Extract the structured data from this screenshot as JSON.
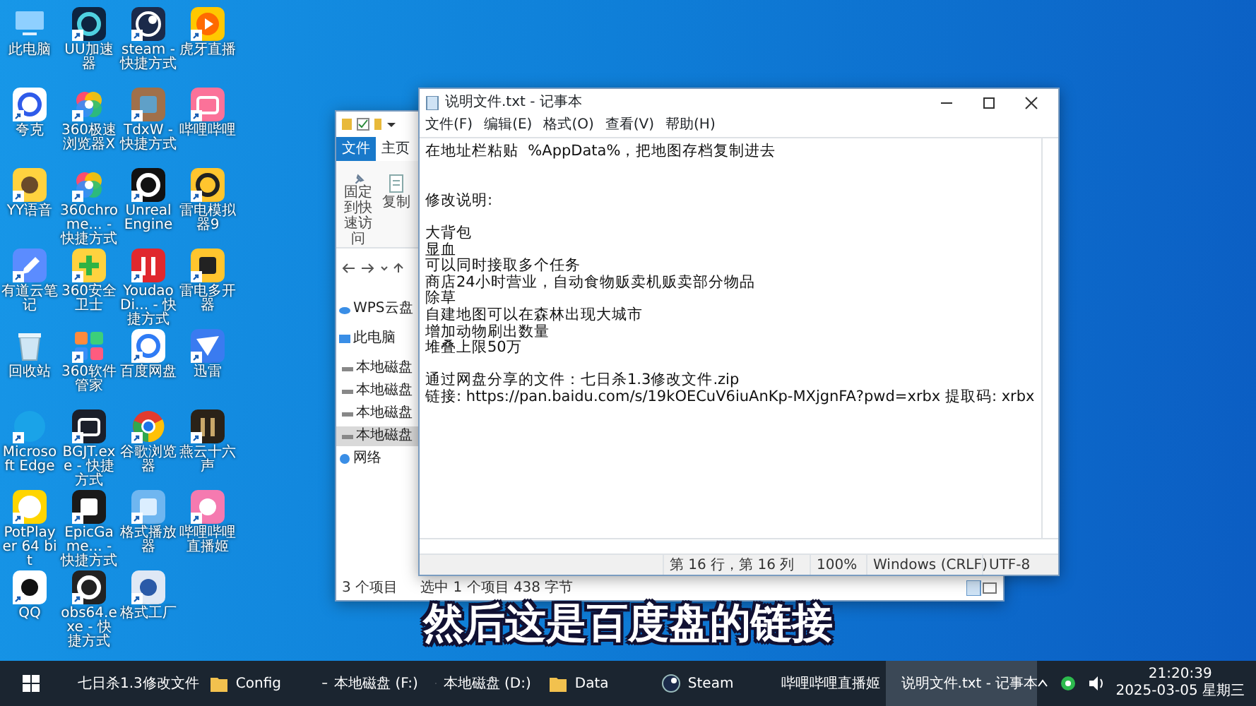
{
  "desktop_icons": [
    {
      "label": "此电脑",
      "shortcut": false
    },
    {
      "label": "UU加速器",
      "shortcut": true
    },
    {
      "label": "steam - 快捷方式",
      "shortcut": true
    },
    {
      "label": "虎牙直播",
      "shortcut": true
    },
    {
      "label": "夸克",
      "shortcut": true
    },
    {
      "label": "360极速浏览器X",
      "shortcut": true
    },
    {
      "label": "TdxW - 快捷方式",
      "shortcut": true
    },
    {
      "label": "哔哩哔哩",
      "shortcut": true
    },
    {
      "label": "YY语音",
      "shortcut": true
    },
    {
      "label": "360chrome... - 快捷方式",
      "shortcut": true
    },
    {
      "label": "Unreal Engine",
      "shortcut": true
    },
    {
      "label": "雷电模拟器9",
      "shortcut": true
    },
    {
      "label": "有道云笔记",
      "shortcut": true
    },
    {
      "label": "360安全卫士",
      "shortcut": true
    },
    {
      "label": "YoudaoDi... - 快捷方式",
      "shortcut": true
    },
    {
      "label": "雷电多开器",
      "shortcut": true
    },
    {
      "label": "回收站",
      "shortcut": false
    },
    {
      "label": "360软件管家",
      "shortcut": true
    },
    {
      "label": "百度网盘",
      "shortcut": true
    },
    {
      "label": "迅雷",
      "shortcut": true
    },
    {
      "label": "Microsoft Edge",
      "shortcut": true
    },
    {
      "label": "BGJT.exe - 快捷方式",
      "shortcut": true
    },
    {
      "label": "谷歌浏览器",
      "shortcut": true
    },
    {
      "label": "燕云十六声",
      "shortcut": true
    },
    {
      "label": "PotPlayer 64 bit",
      "shortcut": true
    },
    {
      "label": "EpicGame... - 快捷方式",
      "shortcut": true
    },
    {
      "label": "格式播放器",
      "shortcut": true
    },
    {
      "label": "哔哩哔哩直播姬",
      "shortcut": true
    },
    {
      "label": "QQ",
      "shortcut": true
    },
    {
      "label": "obs64.exe - 快捷方式",
      "shortcut": true
    },
    {
      "label": "格式工厂",
      "shortcut": true
    }
  ],
  "explorer": {
    "ribbon_tabs": [
      {
        "label": "文件",
        "selected": true
      },
      {
        "label": "主页",
        "selected": false
      }
    ],
    "ribbon_buttons": [
      "固定到快速访问",
      "复制"
    ],
    "nav_items": [
      {
        "label": "WPS云盘",
        "kind": "cloud",
        "selected": false
      },
      {
        "label": "此电脑",
        "kind": "computer",
        "selected": false,
        "children": [
          {
            "label": "本地磁盘",
            "kind": "drive",
            "selected": false
          },
          {
            "label": "本地磁盘",
            "kind": "drive",
            "selected": false
          },
          {
            "label": "本地磁盘",
            "kind": "drive",
            "selected": false
          },
          {
            "label": "本地磁盘",
            "kind": "drive",
            "selected": true
          }
        ]
      },
      {
        "label": "网络",
        "kind": "network",
        "selected": false
      }
    ],
    "status_items": [
      "3 个项目",
      "选中 1 个项目 438 字节"
    ]
  },
  "notepad": {
    "title": "说明文件.txt - 记事本",
    "menu": [
      "文件(F)",
      "编辑(E)",
      "格式(O)",
      "查看(V)",
      "帮助(H)"
    ],
    "blocks": [
      [
        "在地址栏粘贴  %AppData%，把地图存档复制进去"
      ],
      [
        "修改说明:"
      ],
      [
        "大背包",
        "显血",
        "可以同时接取多个任务",
        "商店24小时营业，自动食物贩卖机贩卖部分物品",
        "除草",
        "自建地图可以在森林出现大城市",
        "增加动物刷出数量",
        "堆叠上限50万"
      ],
      [
        "通过网盘分享的文件：七日杀1.3修改文件.zip",
        "链接: https://pan.baidu.com/s/19kOECuV6iuAnKp-MXjgnFA?pwd=xrbx 提取码: xrbx"
      ]
    ],
    "status": [
      "第 16 行，第 16 列",
      "100%",
      "Windows (CRLF)",
      "UTF-8"
    ]
  },
  "subtitle": "然后这是百度盘的链接",
  "taskbar": {
    "items": [
      {
        "label": "七日杀1.3修改文件",
        "kind": "folder",
        "selected": false
      },
      {
        "label": "Config",
        "kind": "folder",
        "selected": false
      },
      {
        "label": "本地磁盘 (F:)",
        "kind": "drive",
        "selected": false
      },
      {
        "label": "本地磁盘 (D:)",
        "kind": "drive",
        "selected": false
      },
      {
        "label": "Data",
        "kind": "folder",
        "selected": false
      },
      {
        "label": "Steam",
        "kind": "steam",
        "selected": false
      },
      {
        "label": "哔哩哔哩直播姬",
        "kind": "app",
        "selected": false
      },
      {
        "label": "说明文件.txt - 记事本",
        "kind": "notepad",
        "selected": true
      }
    ],
    "time": "21:20:39",
    "date": "2025-03-05 星期三"
  }
}
